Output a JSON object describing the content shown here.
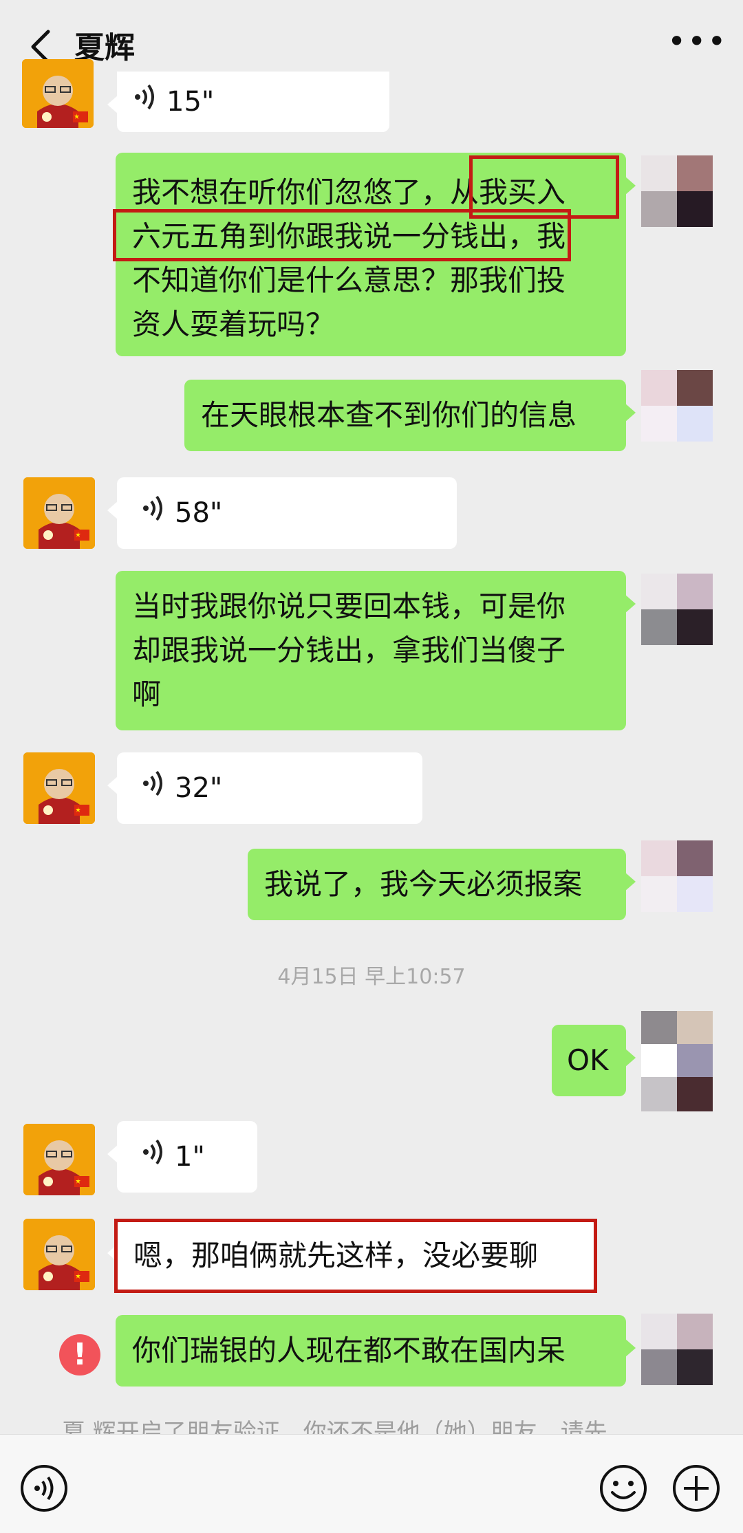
{
  "header": {
    "title": "夏辉"
  },
  "messages": {
    "m1": {
      "duration": "15\""
    },
    "m2": {
      "line1": "我不想在听你们忽悠了，从我买入",
      "line2": "六元五角到你跟我说一分钱出，我",
      "line3": "不知道你们是什么意思？那我们投",
      "line4": "资人耍着玩吗？"
    },
    "m3": {
      "text": "在天眼根本查不到你们的信息"
    },
    "m4": {
      "duration": "58\""
    },
    "m5": {
      "line1": "当时我跟你说只要回本钱，可是你",
      "line2": "却跟我说一分钱出，拿我们当傻子",
      "line3": "啊"
    },
    "m6": {
      "duration": "32\""
    },
    "m7": {
      "text": "我说了，我今天必须报案"
    },
    "timestamp": "4月15日 早上10:57",
    "m8": {
      "text": "OK"
    },
    "m9": {
      "duration": "1\""
    },
    "m10": {
      "text": "嗯，那咱俩就先这样，没必要聊"
    },
    "m11": {
      "text": "你们瑞银的人现在都不敢在国内呆"
    }
  },
  "notice": "夏 辉开启了朋友验证，你还不是他（她）朋友。请先",
  "input": {
    "placeholder": ""
  },
  "colors": {
    "self_bubble": "#95ec69",
    "other_bubble": "#ffffff",
    "highlight_box": "#c31b14",
    "error": "#f2535a"
  }
}
